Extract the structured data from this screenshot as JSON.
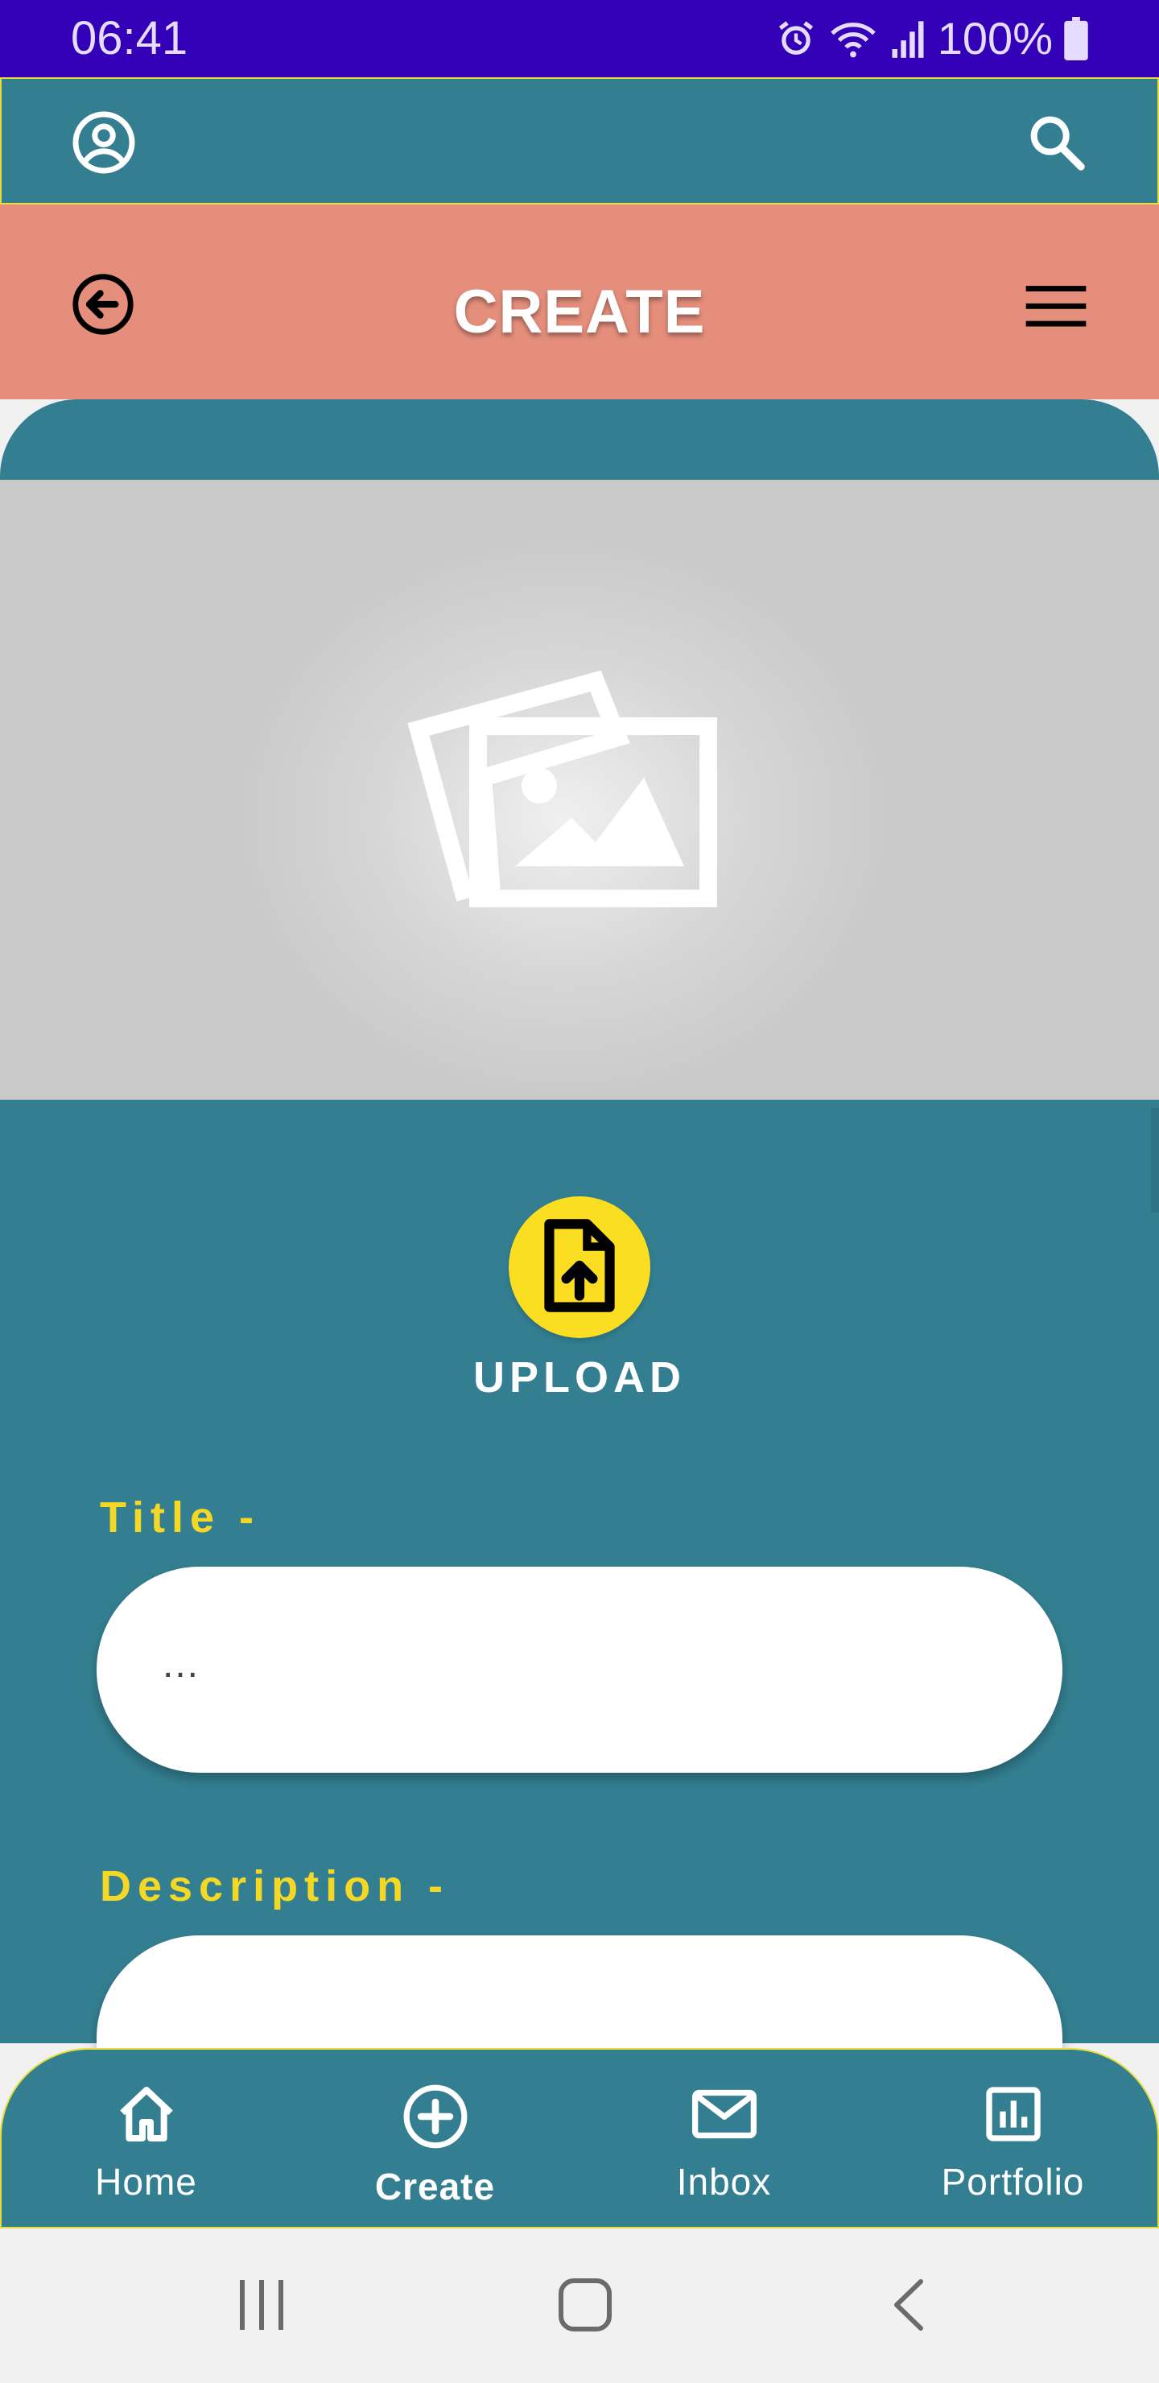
{
  "status_bar": {
    "time": "06:41",
    "battery": "100%",
    "icons": [
      "alarm-icon",
      "wifi-icon",
      "signal-icon",
      "battery-icon"
    ]
  },
  "top_bar": {
    "icons": [
      "account-circle-icon",
      "search-icon"
    ]
  },
  "header": {
    "title": "CREATE",
    "icons": [
      "back-arrow-circle-icon",
      "menu-icon"
    ]
  },
  "image_preview": {
    "icon": "image-placeholder-icon"
  },
  "upload": {
    "label": "UPLOAD",
    "icon": "file-upload-icon"
  },
  "form": {
    "title_label": "Title -",
    "title_value": "...",
    "description_label": "Description -",
    "description_value": ""
  },
  "bottom_nav": {
    "items": [
      {
        "label": "Home",
        "icon": "home-icon",
        "active": false
      },
      {
        "label": "Create",
        "icon": "add-circle-icon",
        "active": true
      },
      {
        "label": "Inbox",
        "icon": "mail-icon",
        "active": false
      },
      {
        "label": "Portfolio",
        "icon": "bar-chart-icon",
        "active": false
      }
    ]
  },
  "colors": {
    "status_bar": "#3300b8",
    "teal": "#337f91",
    "salmon": "#e58e7c",
    "accent_yellow": "#f5d825",
    "upload_button": "#fbdd22"
  }
}
